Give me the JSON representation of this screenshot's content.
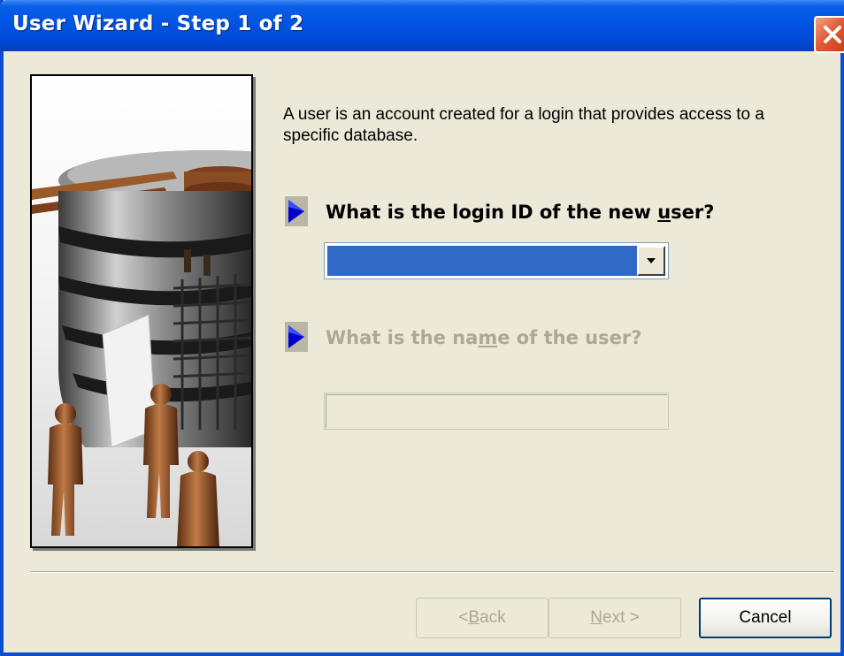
{
  "window": {
    "title": "User Wizard - Step 1 of 2",
    "title_bar_color": "#0054e3",
    "close_icon": "close-icon"
  },
  "intro_text": "A user is an account created for a login that provides access to a specific database.",
  "questions": [
    {
      "text_before": "What is the login ID of the new ",
      "accelerator": "u",
      "text_after": "ser?",
      "enabled": true,
      "control": {
        "type": "combobox",
        "value": "",
        "selected_color": "#316ac5",
        "icon": "chevron-down-icon"
      }
    },
    {
      "text_before": "What is the na",
      "accelerator": "m",
      "text_after": "e of the user?",
      "enabled": false,
      "control": {
        "type": "textbox",
        "value": ""
      }
    }
  ],
  "buttons": {
    "back": {
      "prefix": "< ",
      "accelerator": "B",
      "rest": "ack",
      "enabled": false
    },
    "next": {
      "prefix": "",
      "accelerator": "N",
      "rest": "ext >",
      "enabled": false
    },
    "cancel": {
      "label": "Cancel",
      "enabled": true
    }
  }
}
